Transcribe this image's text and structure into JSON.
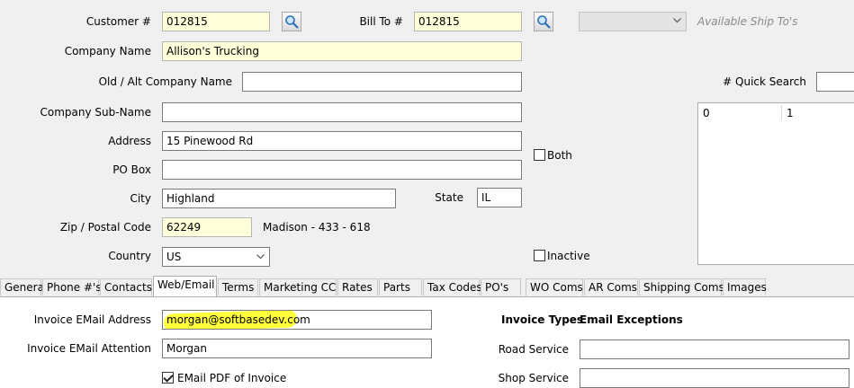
{
  "customer": {
    "label": "Customer #",
    "value": "012815"
  },
  "bill_to": {
    "label": "Bill To #",
    "value": "012815"
  },
  "ship_to": {
    "selected": "",
    "label": "Available Ship To's"
  },
  "company_name": {
    "label": "Company Name",
    "value": "Allison's Trucking"
  },
  "old_alt_company": {
    "label": "Old / Alt Company Name",
    "value": ""
  },
  "quick_search": {
    "label": "# Quick Search",
    "value": ""
  },
  "company_subname": {
    "label": "Company Sub-Name",
    "value": ""
  },
  "address": {
    "label": "Address",
    "value": "15 Pinewood Rd"
  },
  "po_box": {
    "label": "PO Box",
    "value": ""
  },
  "both": {
    "label": "Both",
    "checked": false
  },
  "city": {
    "label": "City",
    "value": "Highland"
  },
  "state": {
    "label": "State",
    "value": "IL"
  },
  "zip": {
    "label": "Zip / Postal Code",
    "value": "62249",
    "county_info": "Madison - 433 - 618"
  },
  "country": {
    "label": "Country",
    "value": "US"
  },
  "inactive": {
    "label": "Inactive",
    "checked": false
  },
  "quick_list": {
    "col1": "0",
    "col2": "1"
  },
  "tabs": [
    {
      "label": "General"
    },
    {
      "label": "Phone #'s"
    },
    {
      "label": "Contacts"
    },
    {
      "label": "Web/Email"
    },
    {
      "label": "Terms"
    },
    {
      "label": "Marketing CC"
    },
    {
      "label": "Rates"
    },
    {
      "label": "Parts"
    },
    {
      "label": "Tax Codes"
    },
    {
      "label": "PO's"
    },
    {
      "label": "WO Coms"
    },
    {
      "label": "AR Coms"
    },
    {
      "label": "Shipping Coms"
    },
    {
      "label": "Images"
    }
  ],
  "active_tab": "Web/Email",
  "web_email": {
    "invoice_email_address": {
      "label": "Invoice EMail Address",
      "value": "morgan@softbasedev.com"
    },
    "invoice_email_attention": {
      "label": "Invoice EMail Attention",
      "value": "Morgan"
    },
    "email_pdf": {
      "label": "EMail PDF of Invoice",
      "checked": true
    },
    "invoice_types_header": "Invoice Types",
    "email_exceptions_header": "Email Exceptions",
    "road_service": {
      "label": "Road Service",
      "value": ""
    },
    "shop_service": {
      "label": "Shop Service",
      "value": ""
    }
  },
  "colors": {
    "required_field_bg": "#ffffd9",
    "highlight": "#ffff3a"
  }
}
